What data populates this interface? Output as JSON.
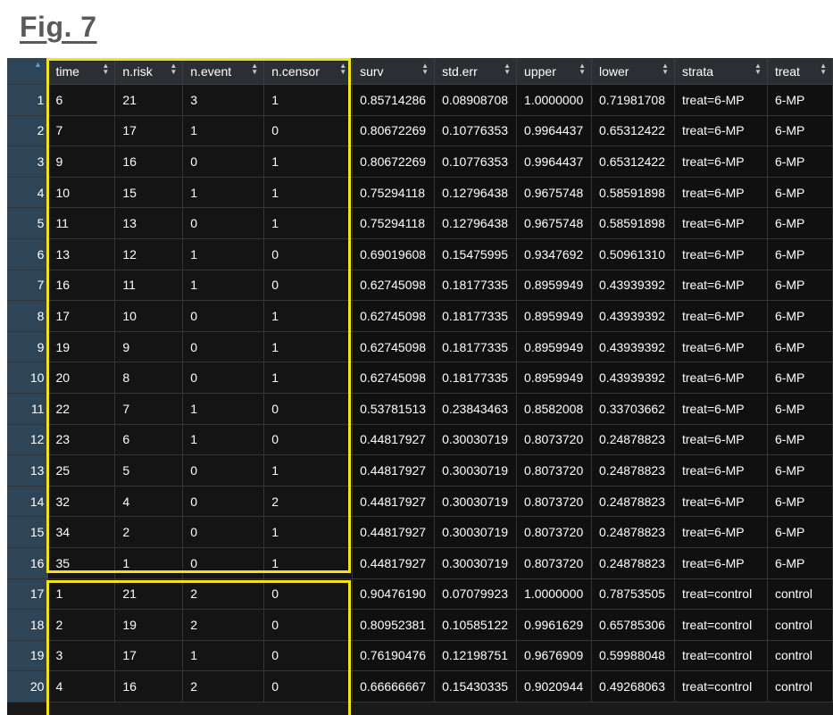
{
  "figure": {
    "title": "Fig. 7"
  },
  "table": {
    "columns": [
      "time",
      "n.risk",
      "n.event",
      "n.censor",
      "surv",
      "std.err",
      "upper",
      "lower",
      "strata",
      "treat"
    ],
    "rows": [
      {
        "n": "1",
        "cells": [
          "6",
          "21",
          "3",
          "1",
          "0.85714286",
          "0.08908708",
          "1.0000000",
          "0.71981708",
          "treat=6-MP",
          "6-MP"
        ]
      },
      {
        "n": "2",
        "cells": [
          "7",
          "17",
          "1",
          "0",
          "0.80672269",
          "0.10776353",
          "0.9964437",
          "0.65312422",
          "treat=6-MP",
          "6-MP"
        ]
      },
      {
        "n": "3",
        "cells": [
          "9",
          "16",
          "0",
          "1",
          "0.80672269",
          "0.10776353",
          "0.9964437",
          "0.65312422",
          "treat=6-MP",
          "6-MP"
        ]
      },
      {
        "n": "4",
        "cells": [
          "10",
          "15",
          "1",
          "1",
          "0.75294118",
          "0.12796438",
          "0.9675748",
          "0.58591898",
          "treat=6-MP",
          "6-MP"
        ]
      },
      {
        "n": "5",
        "cells": [
          "11",
          "13",
          "0",
          "1",
          "0.75294118",
          "0.12796438",
          "0.9675748",
          "0.58591898",
          "treat=6-MP",
          "6-MP"
        ]
      },
      {
        "n": "6",
        "cells": [
          "13",
          "12",
          "1",
          "0",
          "0.69019608",
          "0.15475995",
          "0.9347692",
          "0.50961310",
          "treat=6-MP",
          "6-MP"
        ]
      },
      {
        "n": "7",
        "cells": [
          "16",
          "11",
          "1",
          "0",
          "0.62745098",
          "0.18177335",
          "0.8959949",
          "0.43939392",
          "treat=6-MP",
          "6-MP"
        ]
      },
      {
        "n": "8",
        "cells": [
          "17",
          "10",
          "0",
          "1",
          "0.62745098",
          "0.18177335",
          "0.8959949",
          "0.43939392",
          "treat=6-MP",
          "6-MP"
        ]
      },
      {
        "n": "9",
        "cells": [
          "19",
          "9",
          "0",
          "1",
          "0.62745098",
          "0.18177335",
          "0.8959949",
          "0.43939392",
          "treat=6-MP",
          "6-MP"
        ]
      },
      {
        "n": "10",
        "cells": [
          "20",
          "8",
          "0",
          "1",
          "0.62745098",
          "0.18177335",
          "0.8959949",
          "0.43939392",
          "treat=6-MP",
          "6-MP"
        ]
      },
      {
        "n": "11",
        "cells": [
          "22",
          "7",
          "1",
          "0",
          "0.53781513",
          "0.23843463",
          "0.8582008",
          "0.33703662",
          "treat=6-MP",
          "6-MP"
        ]
      },
      {
        "n": "12",
        "cells": [
          "23",
          "6",
          "1",
          "0",
          "0.44817927",
          "0.30030719",
          "0.8073720",
          "0.24878823",
          "treat=6-MP",
          "6-MP"
        ]
      },
      {
        "n": "13",
        "cells": [
          "25",
          "5",
          "0",
          "1",
          "0.44817927",
          "0.30030719",
          "0.8073720",
          "0.24878823",
          "treat=6-MP",
          "6-MP"
        ]
      },
      {
        "n": "14",
        "cells": [
          "32",
          "4",
          "0",
          "2",
          "0.44817927",
          "0.30030719",
          "0.8073720",
          "0.24878823",
          "treat=6-MP",
          "6-MP"
        ]
      },
      {
        "n": "15",
        "cells": [
          "34",
          "2",
          "0",
          "1",
          "0.44817927",
          "0.30030719",
          "0.8073720",
          "0.24878823",
          "treat=6-MP",
          "6-MP"
        ]
      },
      {
        "n": "16",
        "cells": [
          "35",
          "1",
          "0",
          "1",
          "0.44817927",
          "0.30030719",
          "0.8073720",
          "0.24878823",
          "treat=6-MP",
          "6-MP"
        ]
      },
      {
        "n": "17",
        "cells": [
          "1",
          "21",
          "2",
          "0",
          "0.90476190",
          "0.07079923",
          "1.0000000",
          "0.78753505",
          "treat=control",
          "control"
        ]
      },
      {
        "n": "18",
        "cells": [
          "2",
          "19",
          "2",
          "0",
          "0.80952381",
          "0.10585122",
          "0.9961629",
          "0.65785306",
          "treat=control",
          "control"
        ]
      },
      {
        "n": "19",
        "cells": [
          "3",
          "17",
          "1",
          "0",
          "0.76190476",
          "0.12198751",
          "0.9676909",
          "0.59988048",
          "treat=control",
          "control"
        ]
      },
      {
        "n": "20",
        "cells": [
          "4",
          "16",
          "2",
          "0",
          "0.66666667",
          "0.15430335",
          "0.9020944",
          "0.49268063",
          "treat=control",
          "control"
        ]
      }
    ]
  },
  "colors": {
    "highlight": "#f2e21a",
    "row_header_bg": "#2e4557",
    "cell_bg": "#101010",
    "header_bg": "#2b2f33"
  }
}
